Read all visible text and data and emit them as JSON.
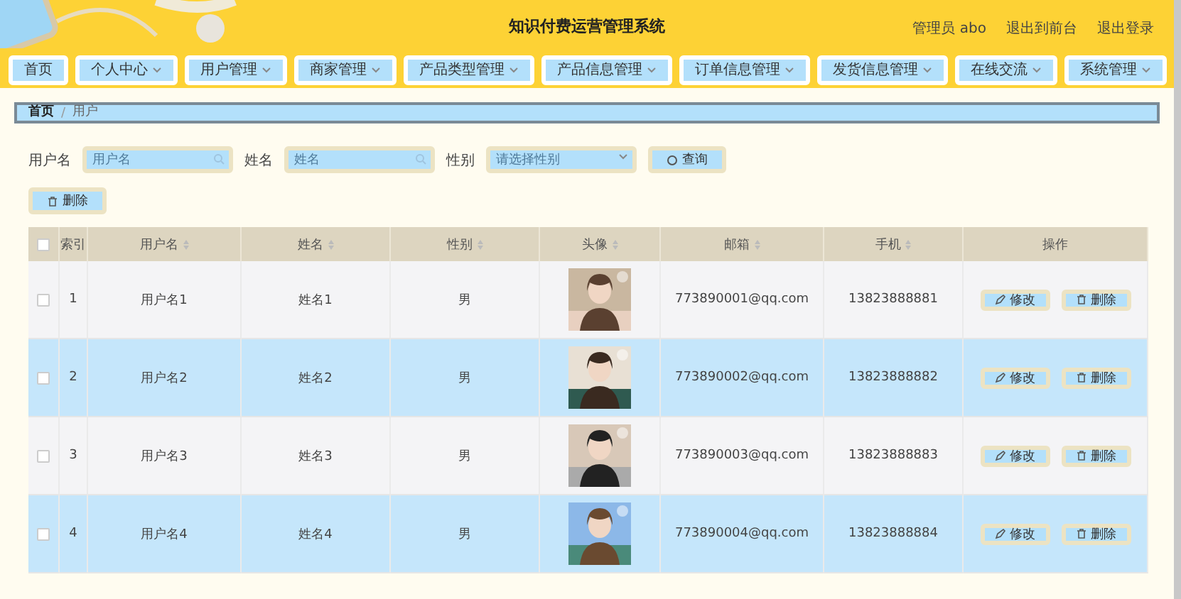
{
  "header": {
    "title": "知识付费运营管理系统",
    "user": "管理员 abo",
    "links": [
      "退出到前台",
      "退出登录"
    ]
  },
  "nav": [
    {
      "label": "首页",
      "dropdown": false
    },
    {
      "label": "个人中心",
      "dropdown": true
    },
    {
      "label": "用户管理",
      "dropdown": true
    },
    {
      "label": "商家管理",
      "dropdown": true
    },
    {
      "label": "产品类型管理",
      "dropdown": true
    },
    {
      "label": "产品信息管理",
      "dropdown": true
    },
    {
      "label": "订单信息管理",
      "dropdown": true
    },
    {
      "label": "发货信息管理",
      "dropdown": true
    },
    {
      "label": "在线交流",
      "dropdown": true
    },
    {
      "label": "系统管理",
      "dropdown": true
    }
  ],
  "breadcrumb": {
    "separator": "/",
    "items": [
      "首页",
      "用户"
    ]
  },
  "search": {
    "fields": [
      {
        "label": "用户名",
        "placeholder": "用户名",
        "kind": "text"
      },
      {
        "label": "姓名",
        "placeholder": "姓名",
        "kind": "text"
      },
      {
        "label": "性别",
        "placeholder": "请选择性别",
        "kind": "select"
      }
    ],
    "button": "查询"
  },
  "bulk_delete": "删除",
  "table": {
    "select_all_checked": false,
    "columns": [
      {
        "label": "索引",
        "sortable": false
      },
      {
        "label": "用户名",
        "sortable": true
      },
      {
        "label": "姓名",
        "sortable": true
      },
      {
        "label": "性别",
        "sortable": true
      },
      {
        "label": "头像",
        "sortable": true
      },
      {
        "label": "邮箱",
        "sortable": true
      },
      {
        "label": "手机",
        "sortable": true
      },
      {
        "label": "操作",
        "sortable": false
      }
    ],
    "rows": [
      {
        "index": "1",
        "username": "用户名1",
        "name": "姓名1",
        "gender": "男",
        "email": "773890001@qq.com",
        "phone": "13823888881",
        "checked": false,
        "highlighted": false,
        "actions": [
          "修改",
          "删除"
        ]
      },
      {
        "index": "2",
        "username": "用户名2",
        "name": "姓名2",
        "gender": "男",
        "email": "773890002@qq.com",
        "phone": "13823888882",
        "checked": false,
        "highlighted": true,
        "actions": [
          "修改",
          "删除"
        ]
      },
      {
        "index": "3",
        "username": "用户名3",
        "name": "姓名3",
        "gender": "男",
        "email": "773890003@qq.com",
        "phone": "13823888883",
        "checked": false,
        "highlighted": false,
        "actions": [
          "修改",
          "删除"
        ]
      },
      {
        "index": "4",
        "username": "用户名4",
        "name": "姓名4",
        "gender": "男",
        "email": "773890004@qq.com",
        "phone": "13823888884",
        "checked": false,
        "highlighted": true,
        "actions": [
          "修改",
          "删除"
        ]
      }
    ]
  }
}
